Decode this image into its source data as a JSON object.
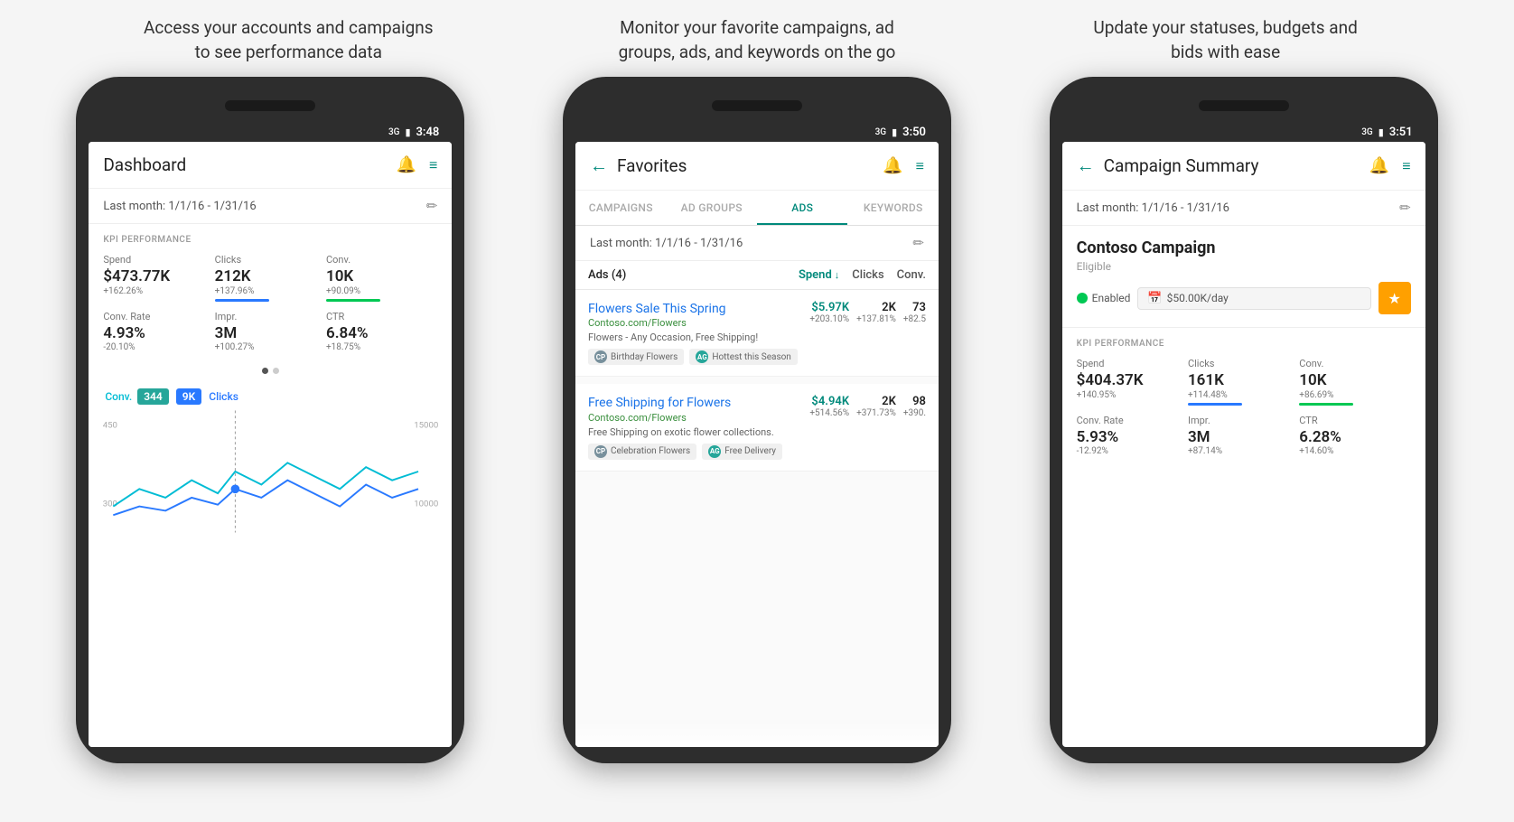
{
  "captions": {
    "phone1": "Access your accounts and campaigns\nto see performance data",
    "phone2": "Monitor your favorite campaigns, ad\ngroups, ads, and keywords on the go",
    "phone3": "Update your statuses, budgets and\nbids with ease"
  },
  "phone1": {
    "status_bar": {
      "signal": "3G",
      "battery": "🔋",
      "time": "3:48"
    },
    "header": {
      "title": "Dashboard",
      "has_back": false
    },
    "date": "Last month: 1/1/16 - 1/31/16",
    "kpi_label": "KPI PERFORMANCE",
    "kpi": [
      {
        "name": "Spend",
        "value": "$473.77K",
        "change": "+162.26%",
        "bar": null
      },
      {
        "name": "Clicks",
        "value": "212K",
        "change": "+137.96%",
        "bar": "blue"
      },
      {
        "name": "Conv.",
        "value": "10K",
        "change": "+90.09%",
        "bar": "green"
      },
      {
        "name": "Conv. Rate",
        "value": "4.93%",
        "change": "-20.10%",
        "bar": null
      },
      {
        "name": "Impr.",
        "value": "3M",
        "change": "+100.27%",
        "bar": null
      },
      {
        "name": "CTR",
        "value": "6.84%",
        "change": "+18.75%",
        "bar": null
      }
    ],
    "chart": {
      "conv_label": "Conv.",
      "bubble1": "344",
      "bubble2": "9K",
      "clicks_label": "Clicks",
      "y_left": [
        "450",
        "300"
      ],
      "y_right": [
        "15000",
        "10000"
      ]
    }
  },
  "phone2": {
    "status_bar": {
      "signal": "3G",
      "battery": "🔋",
      "time": "3:50"
    },
    "header": {
      "title": "Favorites",
      "has_back": true
    },
    "tabs": [
      "CAMPAIGNS",
      "AD GROUPS",
      "ADS",
      "KEYWORDS"
    ],
    "active_tab": "ADS",
    "date": "Last month: 1/1/16 - 1/31/16",
    "ads_count": "Ads (4)",
    "ads_col_spend": "Spend",
    "ads_col_clicks": "Clicks",
    "ads_col_conv": "Conv.",
    "ads": [
      {
        "title": "Flowers Sale This Spring",
        "url": "Contoso.com/Flowers",
        "desc": "Flowers - Any Occasion, Free Shipping!",
        "spend": "$5.97K",
        "spend_change": "+203.10%",
        "clicks": "2K",
        "clicks_change": "+137.81%",
        "conv": "73",
        "conv_change": "+82.5",
        "tags": [
          {
            "type": "CP",
            "label": "Birthday Flowers"
          },
          {
            "type": "AG",
            "label": "Hottest this Season"
          }
        ]
      },
      {
        "title": "Free Shipping for Flowers",
        "url": "Contoso.com/Flowers",
        "desc": "Free Shipping on exotic flower collections.",
        "spend": "$4.94K",
        "spend_change": "+514.56%",
        "clicks": "2K",
        "clicks_change": "+371.73%",
        "conv": "98",
        "conv_change": "+390.",
        "tags": [
          {
            "type": "CP",
            "label": "Celebration Flowers"
          },
          {
            "type": "AG",
            "label": "Free Delivery"
          }
        ]
      }
    ]
  },
  "phone3": {
    "status_bar": {
      "signal": "3G",
      "battery": "🔋",
      "time": "3:51"
    },
    "header": {
      "title": "Campaign Summary",
      "has_back": true
    },
    "date": "Last month: 1/1/16 - 1/31/16",
    "campaign_name": "Contoso Campaign",
    "campaign_status": "Eligible",
    "enabled_label": "Enabled",
    "budget": "$50.00K/day",
    "kpi_label": "KPI PERFORMANCE",
    "kpi": [
      {
        "name": "Spend",
        "value": "$404.37K",
        "change": "+140.95%",
        "bar": null
      },
      {
        "name": "Clicks",
        "value": "161K",
        "change": "+114.48%",
        "bar": "blue"
      },
      {
        "name": "Conv.",
        "value": "10K",
        "change": "+86.69%",
        "bar": "green"
      },
      {
        "name": "Conv. Rate",
        "value": "5.93%",
        "change": "-12.92%",
        "bar": null
      },
      {
        "name": "Impr.",
        "value": "3M",
        "change": "+87.14%",
        "bar": null
      },
      {
        "name": "CTR",
        "value": "6.28%",
        "change": "+14.60%",
        "bar": null
      }
    ]
  },
  "icons": {
    "back": "←",
    "bell": "🔔",
    "menu": "≡",
    "edit": "✏",
    "sort_down": "↓",
    "star": "★",
    "calendar": "📅",
    "check": "✓"
  }
}
